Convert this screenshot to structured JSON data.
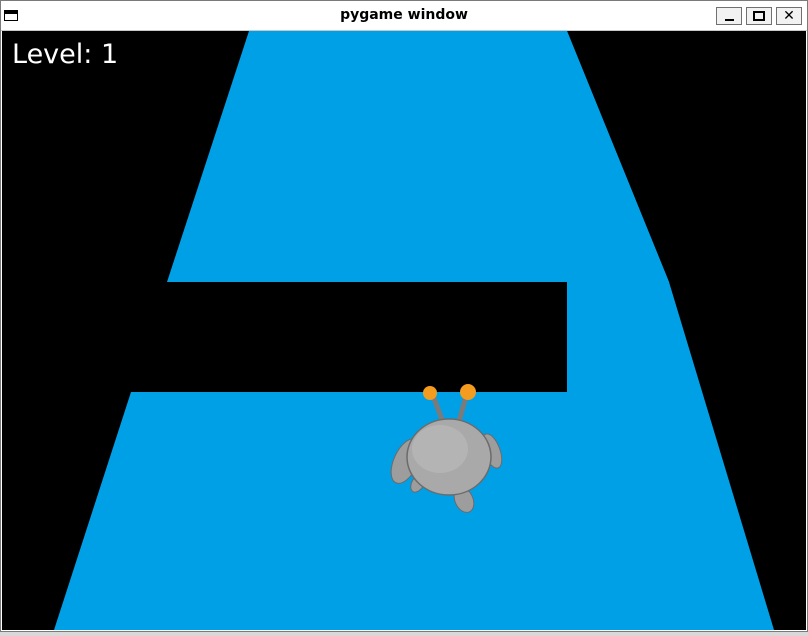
{
  "window": {
    "title": "pygame window",
    "controls": [
      "minimize",
      "maximize",
      "close"
    ],
    "close_glyph": "✕"
  },
  "hud": {
    "level_text": "Level: 1"
  },
  "scene": {
    "background_color": "#000000",
    "track_color": "#00a0e6",
    "player": {
      "body_color": "#a9a9a9",
      "antenna_tip_color": "#f39c1f"
    }
  }
}
